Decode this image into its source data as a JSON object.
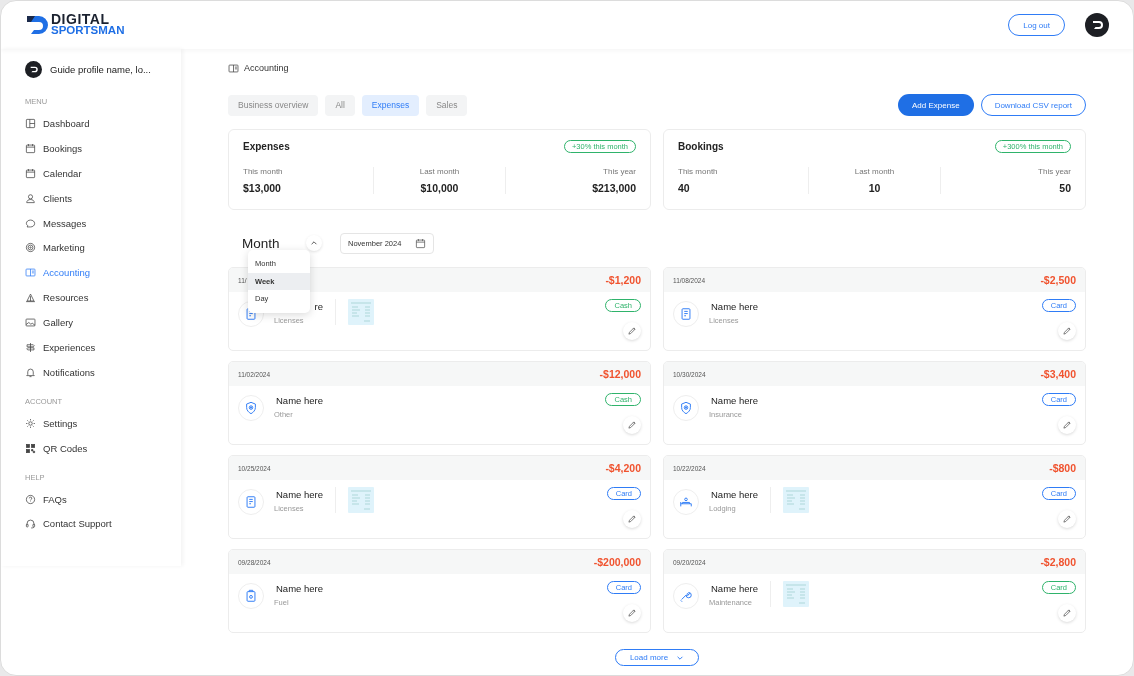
{
  "header": {
    "logo_top": "DIGITAL",
    "logo_bottom": "SPORTSMAN",
    "logout": "Log out"
  },
  "sidebar": {
    "profile": "Guide profile name, lo...",
    "sections": [
      {
        "title": "MENU",
        "items": [
          {
            "label": "Dashboard",
            "selected": false
          },
          {
            "label": "Bookings",
            "selected": false
          },
          {
            "label": "Calendar",
            "selected": false
          },
          {
            "label": "Clients",
            "selected": false
          },
          {
            "label": "Messages",
            "selected": false
          },
          {
            "label": "Marketing",
            "selected": false
          },
          {
            "label": "Accounting",
            "selected": true
          },
          {
            "label": "Resources",
            "selected": false
          },
          {
            "label": "Gallery",
            "selected": false
          },
          {
            "label": "Experiences",
            "selected": false
          },
          {
            "label": "Notifications",
            "selected": false
          }
        ]
      },
      {
        "title": "ACCOUNT",
        "items": [
          {
            "label": "Settings",
            "selected": false
          },
          {
            "label": "QR Codes",
            "selected": false
          }
        ]
      },
      {
        "title": "HELP",
        "items": [
          {
            "label": "FAQs",
            "selected": false
          },
          {
            "label": "Contact Support",
            "selected": false
          }
        ]
      }
    ]
  },
  "breadcrumb": "Accounting",
  "tabs": [
    {
      "label": "Business overview",
      "selected": false
    },
    {
      "label": "All",
      "selected": false
    },
    {
      "label": "Expenses",
      "selected": true
    },
    {
      "label": "Sales",
      "selected": false
    }
  ],
  "actions": {
    "primary": "Add Expense",
    "secondary": "Download CSV report"
  },
  "stats": [
    {
      "title": "Expenses",
      "badge": "+30% this month",
      "cells": [
        {
          "label": "This month",
          "value": "$13,000"
        },
        {
          "label": "Last month",
          "value": "$10,000"
        },
        {
          "label": "This year",
          "value": "$213,000"
        }
      ]
    },
    {
      "title": "Bookings",
      "badge": "+300% this month",
      "cells": [
        {
          "label": "This month",
          "value": "40"
        },
        {
          "label": "Last month",
          "value": "10"
        },
        {
          "label": "This year",
          "value": "50"
        }
      ]
    }
  ],
  "period": {
    "value": "Month",
    "date": "November 2024",
    "options": [
      {
        "label": "Month",
        "highlighted": false
      },
      {
        "label": "Week",
        "highlighted": true
      },
      {
        "label": "Day",
        "highlighted": false
      }
    ]
  },
  "expenses": [
    {
      "date": "11/",
      "amount": "-$1,200",
      "name": "re",
      "category": "Licenses",
      "receipt": true,
      "method": "Cash",
      "color": "#2fb36b"
    },
    {
      "date": "11/08/2024",
      "amount": "-$2,500",
      "name": "Name here",
      "category": "Licenses",
      "receipt": false,
      "method": "Card",
      "color": "#2f7cf6"
    },
    {
      "date": "11/02/2024",
      "amount": "-$12,000",
      "name": "Name here",
      "category": "Other",
      "receipt": false,
      "method": "Cash",
      "color": "#2fb36b"
    },
    {
      "date": "10/30/2024",
      "amount": "-$3,400",
      "name": "Name here",
      "category": "Insurance",
      "receipt": false,
      "method": "Card",
      "color": "#2f7cf6"
    },
    {
      "date": "10/25/2024",
      "amount": "-$4,200",
      "name": "Name here",
      "category": "Licenses",
      "receipt": true,
      "method": "Card",
      "color": "#2f7cf6"
    },
    {
      "date": "10/22/2024",
      "amount": "-$800",
      "name": "Name here",
      "category": "Lodging",
      "receipt": true,
      "method": "Card",
      "color": "#2f7cf6"
    },
    {
      "date": "09/28/2024",
      "amount": "-$200,000",
      "name": "Name here",
      "category": "Fuel",
      "receipt": false,
      "method": "Card",
      "color": "#2f7cf6"
    },
    {
      "date": "09/20/2024",
      "amount": "-$2,800",
      "name": "Name here",
      "category": "Maintenance",
      "receipt": true,
      "method": "Card",
      "color": "#2fb36b"
    }
  ],
  "load_more": "Load more"
}
